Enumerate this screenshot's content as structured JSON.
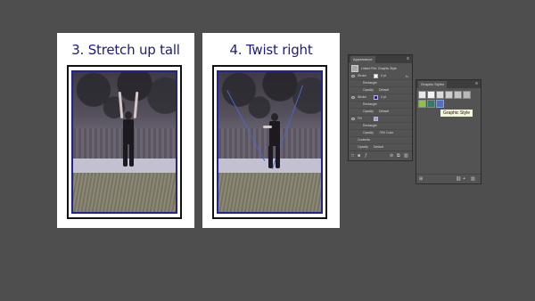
{
  "artboards": [
    {
      "title": "3. Stretch up tall"
    },
    {
      "title": "4. Twist right"
    }
  ],
  "appearance_panel": {
    "tab": "Appearance",
    "menu_icon": "panel-menu-icon",
    "object": "Linked File: Graphic Style",
    "rows": [
      {
        "kind": "Stroke",
        "value": "0 pt"
      },
      {
        "kind": "Rectangle",
        "value": ""
      },
      {
        "kind": "Opacity",
        "value": "Default"
      },
      {
        "kind": "Stroke",
        "value": "0 pt"
      },
      {
        "kind": "Rectangle",
        "value": ""
      },
      {
        "kind": "Opacity",
        "value": "Default"
      },
      {
        "kind": "Fill",
        "value": ""
      },
      {
        "kind": "Rectangle",
        "value": ""
      },
      {
        "kind": "Opacity",
        "value": "75% Color"
      },
      {
        "kind": "Contents",
        "value": ""
      },
      {
        "kind": "Opacity",
        "value": "Default"
      }
    ]
  },
  "graphic_styles_panel": {
    "tab": "Graphic Styles",
    "tooltip": "Graphic Style",
    "accent": "#6fa8dc"
  }
}
